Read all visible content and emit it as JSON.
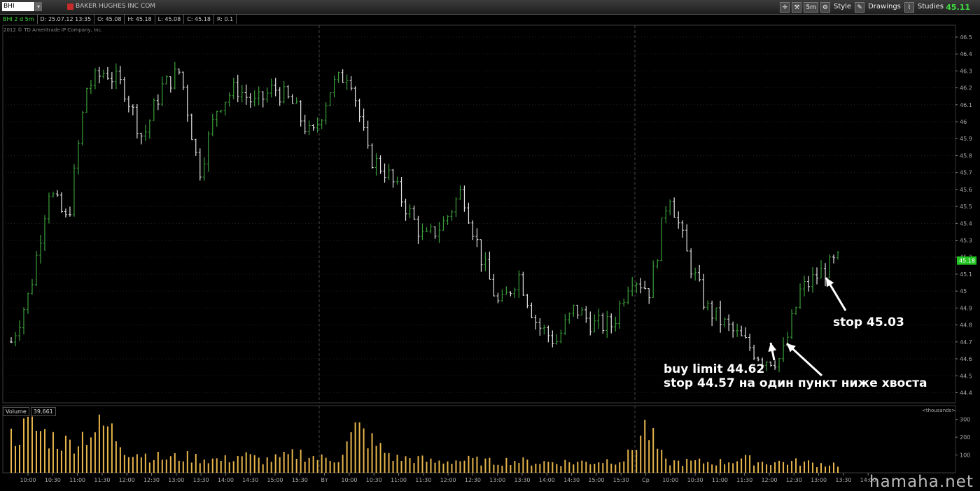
{
  "toolbar": {
    "symbol": "BHI",
    "company_name": "BAKER HUGHES INC COM",
    "timeframe": "5m",
    "style_label": "Style",
    "drawings_label": "Drawings",
    "studies_label": "Studies",
    "last_price": "45.11"
  },
  "info": {
    "chart_label": "BHI 2 d 5m",
    "date": "D: 25.07.12 13:35",
    "open": "O: 45.08",
    "high": "H: 45.18",
    "low": "L: 45.08",
    "close": "C: 45.18",
    "range": "R: 0.1"
  },
  "copyright": "2012 © TD Ameritrade IP Company, Inc.",
  "price_marker": "45.18",
  "volume": {
    "label": "Volume",
    "value": "39,661",
    "units": "<thousands>",
    "axis_ticks": [
      "300",
      "200",
      "100"
    ]
  },
  "annotations": {
    "buy_line1": "buy limit 44.62",
    "buy_line2": "stop 44.57 на один пункт ниже хвоста",
    "stop": "stop 45.03"
  },
  "watermark": "hamaha.net",
  "colors": {
    "up": "#3a9e3a",
    "down": "#e6e6e6",
    "volume": "#e8b64b",
    "price_tag": "#22c422"
  },
  "chart_data": {
    "type": "ohlc",
    "y_ticks": [
      46.5,
      46.4,
      46.3,
      46.2,
      46.1,
      46,
      45.9,
      45.8,
      45.7,
      45.6,
      45.5,
      45.4,
      45.3,
      45.2,
      45.1,
      45,
      44.9,
      44.8,
      44.7,
      44.6,
      44.5,
      44.4
    ],
    "ylim": [
      44.34,
      46.57
    ],
    "x_tick_labels": [
      "10:00",
      "10:30",
      "11:00",
      "11:30",
      "12:00",
      "12:30",
      "13:00",
      "13:30",
      "14:00",
      "14:30",
      "15:00",
      "15:30",
      "Вт",
      "10:00",
      "10:30",
      "11:00",
      "11:30",
      "12:00",
      "12:30",
      "13:00",
      "13:30",
      "14:00",
      "14:30",
      "15:00",
      "15:30",
      "Ср",
      "10:00",
      "10:30",
      "11:00",
      "11:30",
      "12:00",
      "12:30",
      "13:00",
      "13:30",
      "14:00"
    ],
    "anchor_prices": [
      44.7,
      45.0,
      45.6,
      45.4,
      46.2,
      46.3,
      46.2,
      45.9,
      46.2,
      46.3,
      45.7,
      46.1,
      46.2,
      46.1,
      46.2,
      46.1,
      45.9,
      46.2,
      46.3,
      45.8,
      45.7,
      45.5,
      45.3,
      45.4,
      45.6,
      45.2,
      44.9,
      45.1,
      44.8,
      44.7,
      44.9,
      44.8,
      44.8,
      45.1,
      45.0,
      45.6,
      45.2,
      44.9,
      44.8,
      44.7,
      44.6,
      44.6,
      45.0,
      45.1,
      45.18
    ],
    "volume_anchors": [
      200,
      260,
      200,
      160,
      230,
      260,
      130,
      100,
      80,
      90,
      80,
      70,
      100,
      70,
      80,
      110,
      80,
      80,
      250,
      150,
      80,
      80,
      60,
      70,
      70,
      60,
      70,
      60,
      60,
      60,
      60,
      70,
      80,
      260,
      60,
      60,
      60,
      60,
      80,
      60,
      60,
      60,
      50,
      50
    ]
  }
}
